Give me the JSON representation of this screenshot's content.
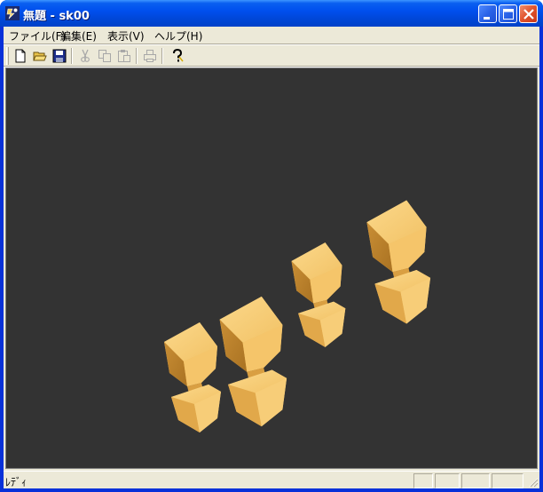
{
  "window": {
    "title": "無題 - sk00",
    "app_icon": "sketch-app-icon",
    "controls": [
      "minimize-icon",
      "maximize-icon",
      "close-icon"
    ]
  },
  "menubar": {
    "items": [
      {
        "label": "ファイル(F)"
      },
      {
        "label": "編集(E)"
      },
      {
        "label": "表示(V)"
      },
      {
        "label": "ヘルプ(H)"
      }
    ]
  },
  "toolbar": {
    "buttons": [
      {
        "icon": "new-file-icon",
        "enabled": true
      },
      {
        "icon": "open-folder-icon",
        "enabled": true
      },
      {
        "icon": "save-icon",
        "enabled": true
      },
      {
        "icon": "cut-icon",
        "enabled": false
      },
      {
        "icon": "copy-icon",
        "enabled": false
      },
      {
        "icon": "paste-icon",
        "enabled": false
      },
      {
        "icon": "print-icon",
        "enabled": false
      },
      {
        "icon": "help-icon",
        "enabled": true
      }
    ]
  },
  "viewport": {
    "background": "#333333",
    "object_color": "#f2c266",
    "object_count": 4
  },
  "statusbar": {
    "text": "ﾚﾃﾞｨ",
    "panes": 4
  }
}
